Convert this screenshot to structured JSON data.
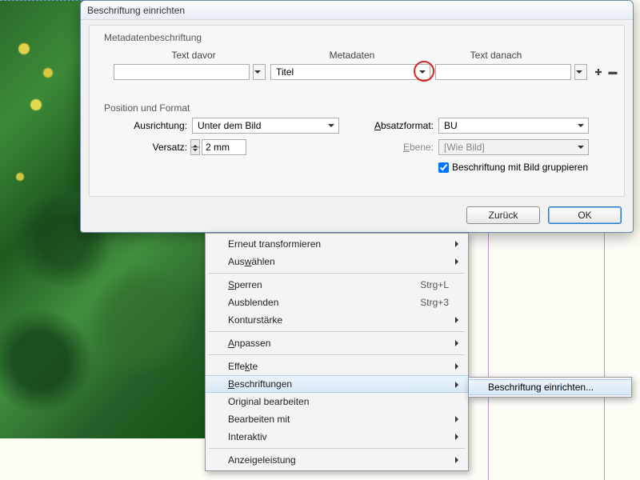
{
  "dialog": {
    "title": "Beschriftung einrichten",
    "group_metadata": "Metadatenbeschriftung",
    "col_before": "Text davor",
    "col_meta": "Metadaten",
    "col_after": "Text danach",
    "meta_value": "Titel",
    "group_position": "Position und Format",
    "align_label": "Ausrichtung:",
    "align_value": "Unter dem Bild",
    "offset_label": "Versatz:",
    "offset_value": "2 mm",
    "paraformat_label": "Absatzformat:",
    "paraformat_value": "BU",
    "layer_label": "Ebene:",
    "layer_value": "[Wie Bild]",
    "group_checkbox": "Beschriftung mit Bild gruppieren",
    "btn_back": "Zurück",
    "btn_ok": "OK"
  },
  "menu": {
    "items": [
      {
        "label": "Erneut transformieren",
        "sub": true
      },
      {
        "label_pre": "Aus",
        "u": "w",
        "label_post": "ählen",
        "sub": true
      },
      {
        "sep": true
      },
      {
        "label_pre": "",
        "u": "S",
        "label_post": "perren",
        "shortcut": "Strg+L"
      },
      {
        "label": "Ausblenden",
        "shortcut": "Strg+3"
      },
      {
        "label": "Konturstärke",
        "sub": true
      },
      {
        "sep": true
      },
      {
        "label_pre": "",
        "u": "A",
        "label_post": "npassen",
        "sub": true
      },
      {
        "sep": true
      },
      {
        "label_pre": "Effe",
        "u": "k",
        "label_post": "te",
        "sub": true
      },
      {
        "label_pre": "",
        "u": "B",
        "label_post": "eschriftungen",
        "sub": true,
        "hover": true
      },
      {
        "label": "Original bearbeiten"
      },
      {
        "label": "Bearbeiten mit",
        "sub": true
      },
      {
        "label": "Interaktiv",
        "sub": true
      },
      {
        "sep": true
      },
      {
        "label": "Anzeigeleistung",
        "sub": true
      }
    ],
    "submenu_item": "Beschriftung einrichten..."
  }
}
